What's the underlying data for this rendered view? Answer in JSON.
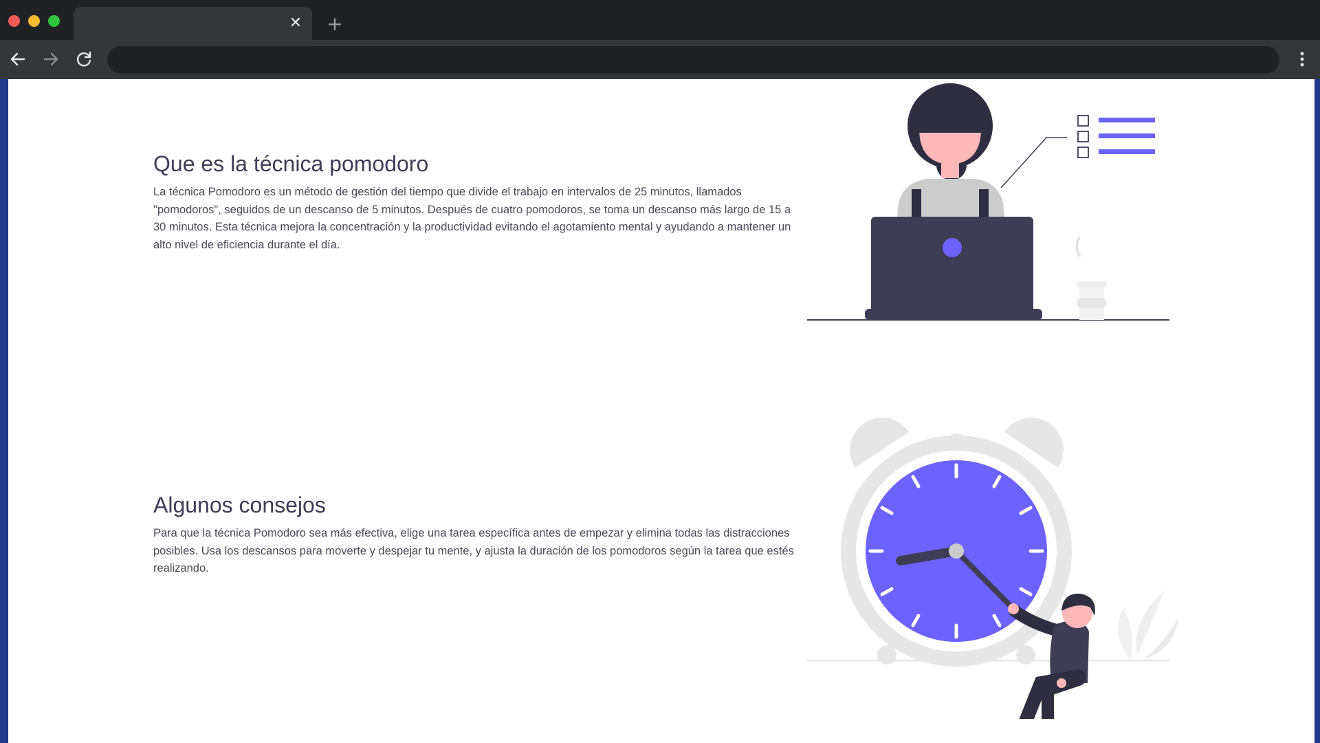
{
  "browser": {
    "tab_title": "",
    "tab_close_glyph": "✕",
    "new_tab_glyph": "+",
    "address_value": "",
    "address_placeholder": "",
    "icons": [
      "back-arrow-icon",
      "forward-arrow-icon",
      "reload-icon",
      "more-vert-icon"
    ]
  },
  "sections": [
    {
      "title": "Que es la técnica pomodoro",
      "text": "La técnica Pomodoro es un método de gestión del tiempo que divide el trabajo en intervalos de 25 minutos, llamados \"pomodoros\", seguidos de un descanso de 5 minutos. Después de cuatro pomodoros, se toma un descanso más largo de 15 a 30 minutos. Esta técnica mejora la concentración y la productividad evitando el agotamiento mental y ayudando a mantener un alto nivel de eficiencia durante el día."
    },
    {
      "title": "Algunos consejos",
      "text": "Para que la técnica Pomodoro sea más efectiva, elige una tarea específica antes de empezar y elimina todas las distracciones posibles. Usa los descansos para moverte y despejar tu mente, y ajusta la duración de los pomodoros según la tarea que estés realizando."
    }
  ],
  "colors": {
    "accent": "#6c63ff",
    "dark": "#3f3d56",
    "light_gray": "#e6e6e6",
    "viewport_border": "#233a8a"
  }
}
